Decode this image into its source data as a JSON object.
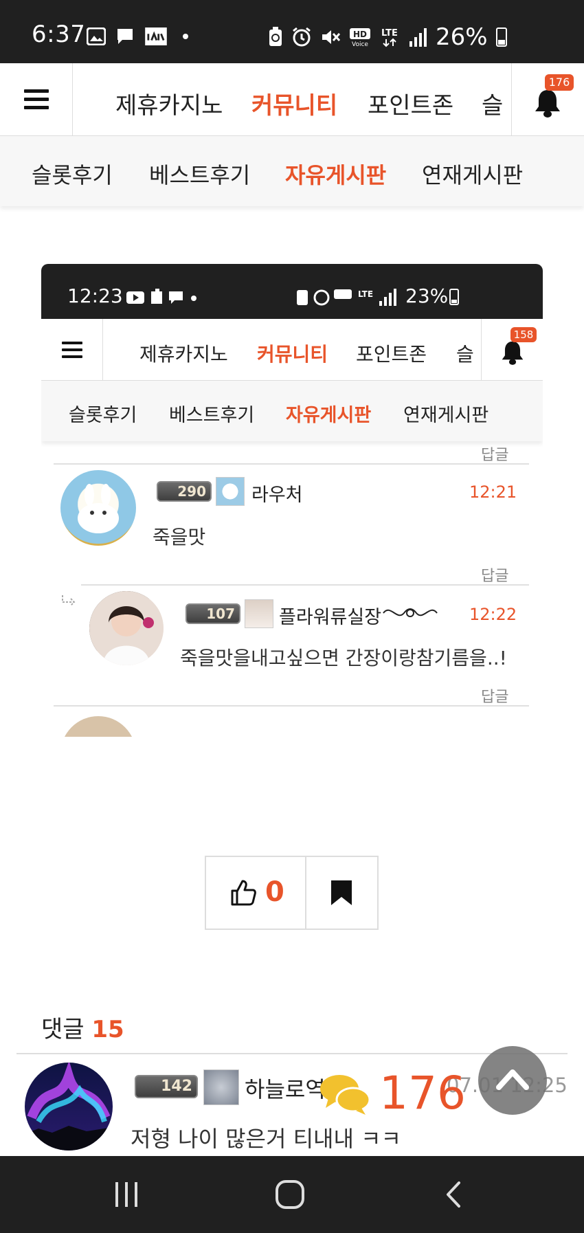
{
  "status_bar": {
    "time": "6:37",
    "battery": "26%",
    "battery_level": 0.26,
    "icons_left": [
      "gallery-icon",
      "chat-icon",
      "app-icon",
      "dot-icon"
    ],
    "icons_right": [
      "battery-saver-icon",
      "alarm-icon",
      "mute-icon",
      "hd-voice-icon",
      "lte-icon",
      "signal-icon",
      "battery-icon"
    ]
  },
  "top_nav": {
    "tabs": [
      "제휴카지노",
      "커뮤니티",
      "포인트존",
      "슬"
    ],
    "active_tab": "커뮤니티",
    "notification_count": "176"
  },
  "sub_nav": {
    "items": [
      "슬롯후기",
      "베스트후기",
      "자유게시판",
      "연재게시판"
    ],
    "active": "자유게시판"
  },
  "embedded_screenshot": {
    "status_bar": {
      "time": "12:23",
      "battery": "23%",
      "battery_level": 0.23
    },
    "top_nav": {
      "tabs": [
        "제휴카지노",
        "커뮤니티",
        "포인트존",
        "슬"
      ],
      "notification_count": "158"
    },
    "sub_nav": {
      "items": [
        "슬롯후기",
        "베스트후기",
        "자유게시판",
        "연재게시판"
      ]
    },
    "reply_label": "답글",
    "comments": [
      {
        "level": "290",
        "nickname": "라우처",
        "time": "12:21",
        "text": "죽을맛"
      },
      {
        "level": "107",
        "nickname": "플라워류실장",
        "time": "12:22",
        "text": "죽을맛을내고싶으면 간장이랑참기름을..!"
      }
    ]
  },
  "post_actions": {
    "like_count": "0"
  },
  "comments_section": {
    "label": "댓글",
    "count": "15",
    "first_comment": {
      "level": "142",
      "nickname": "하늘로역",
      "time": "07.01 12:25",
      "text": "저형 나이 많은거 티내내 ㅋㅋ"
    }
  },
  "floating": {
    "comment_count": "176"
  },
  "colors": {
    "accent": "#e8542a",
    "statusbar": "#202020",
    "bubble": "#f2c12e"
  }
}
